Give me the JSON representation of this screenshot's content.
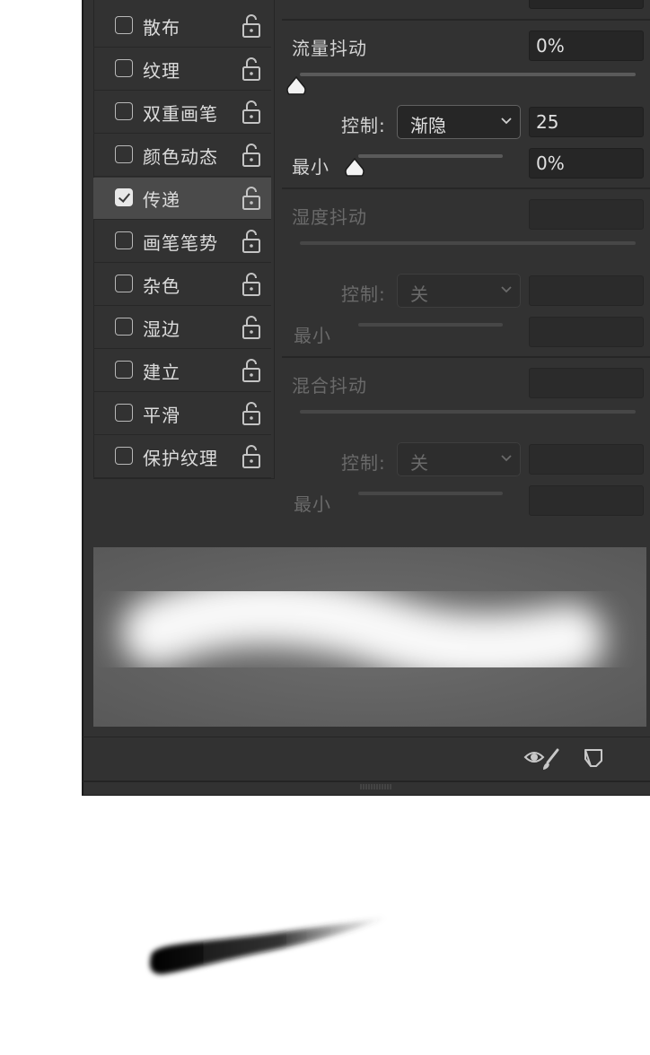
{
  "options": [
    {
      "label": "散布",
      "checked": false,
      "active": false
    },
    {
      "label": "纹理",
      "checked": false,
      "active": false
    },
    {
      "label": "双重画笔",
      "checked": false,
      "active": false
    },
    {
      "label": "颜色动态",
      "checked": false,
      "active": false
    },
    {
      "label": "传递",
      "checked": true,
      "active": true
    },
    {
      "label": "画笔笔势",
      "checked": false,
      "active": false
    },
    {
      "label": "杂色",
      "checked": false,
      "active": false
    },
    {
      "label": "湿边",
      "checked": false,
      "active": false
    },
    {
      "label": "建立",
      "checked": false,
      "active": false
    },
    {
      "label": "平滑",
      "checked": false,
      "active": false
    },
    {
      "label": "保护纹理",
      "checked": false,
      "active": false
    }
  ],
  "flow": {
    "label": "流量抖动",
    "value": "0%",
    "slider_fraction": 0,
    "control_label": "控制:",
    "control_value": "渐隐",
    "control_amount": "25",
    "min_label": "最小",
    "min_value": "0%",
    "min_fraction": 0
  },
  "wetness": {
    "label": "湿度抖动",
    "control_label": "控制:",
    "control_value": "关",
    "min_label": "最小"
  },
  "mix": {
    "label": "混合抖动",
    "control_label": "控制:",
    "control_value": "关",
    "min_label": "最小"
  },
  "colors": {
    "panel": "#323232",
    "active_row": "#4a4a4a",
    "field": "#262626"
  },
  "footer_icons": [
    "eye-brush-icon",
    "new-preset-icon"
  ]
}
